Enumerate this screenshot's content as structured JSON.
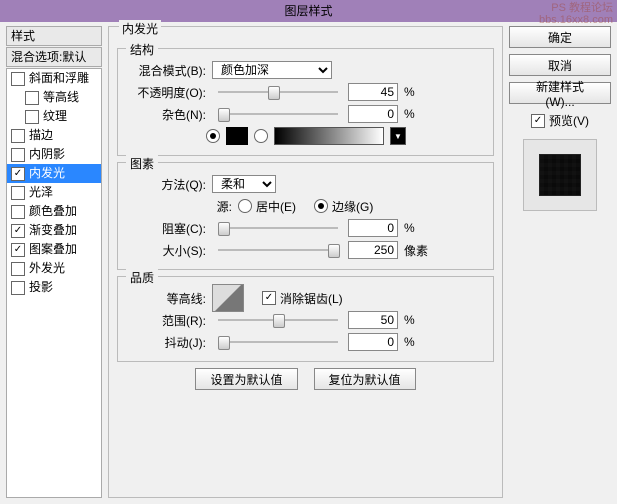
{
  "title": "图层样式",
  "watermark_line1": "PS 教程论坛",
  "watermark_line2": "bbs.16xx8.com",
  "left": {
    "header": "样式",
    "sub": "混合选项:默认",
    "items": [
      {
        "label": "斜面和浮雕",
        "checked": false
      },
      {
        "label": "等高线",
        "checked": false,
        "indent": true
      },
      {
        "label": "纹理",
        "checked": false,
        "indent": true
      },
      {
        "label": "描边",
        "checked": false
      },
      {
        "label": "内阴影",
        "checked": false
      },
      {
        "label": "内发光",
        "checked": true,
        "selected": true
      },
      {
        "label": "光泽",
        "checked": false
      },
      {
        "label": "颜色叠加",
        "checked": false
      },
      {
        "label": "渐变叠加",
        "checked": true
      },
      {
        "label": "图案叠加",
        "checked": true
      },
      {
        "label": "外发光",
        "checked": false
      },
      {
        "label": "投影",
        "checked": false
      }
    ]
  },
  "center": {
    "title": "内发光",
    "g1": {
      "title": "结构",
      "blend_label": "混合模式(B):",
      "blend_value": "颜色加深",
      "opacity_label": "不透明度(O):",
      "opacity_value": "45",
      "opacity_pct": 45,
      "noise_label": "杂色(N):",
      "noise_value": "0",
      "noise_pct": 0,
      "pct": "%"
    },
    "g2": {
      "title": "图素",
      "tech_label": "方法(Q):",
      "tech_value": "柔和",
      "source_label": "源:",
      "center": "居中(E)",
      "edge": "边缘(G)",
      "choke_label": "阻塞(C):",
      "choke_value": "0",
      "choke_pct": 0,
      "size_label": "大小(S):",
      "size_value": "250",
      "size_pct": 100,
      "size_unit": "像素",
      "pct": "%"
    },
    "g3": {
      "title": "品质",
      "contour_label": "等高线:",
      "aa": "消除锯齿(L)",
      "range_label": "范围(R):",
      "range_value": "50",
      "range_pct": 50,
      "jitter_label": "抖动(J):",
      "jitter_value": "0",
      "jitter_pct": 0,
      "pct": "%"
    },
    "btn_default": "设置为默认值",
    "btn_reset": "复位为默认值"
  },
  "right": {
    "ok": "确定",
    "cancel": "取消",
    "newstyle": "新建样式(W)...",
    "preview": "预览(V)"
  }
}
